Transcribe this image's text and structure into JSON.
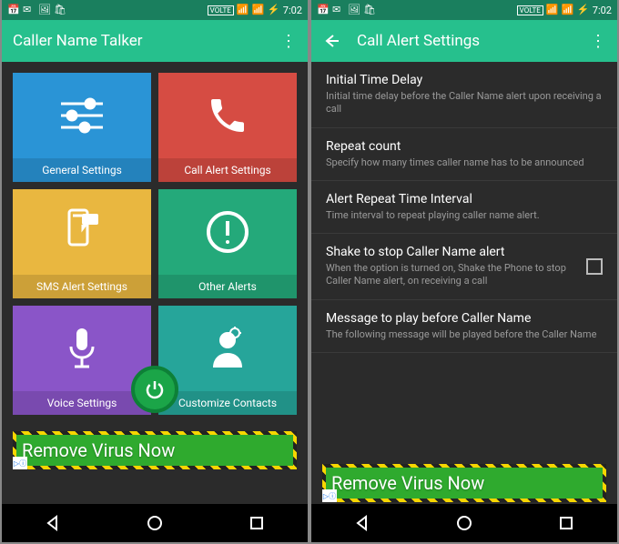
{
  "status": {
    "time": "7:02",
    "volte": "VOLTE"
  },
  "left": {
    "title": "Caller Name Talker",
    "tiles": [
      {
        "label": "General Settings"
      },
      {
        "label": "Call Alert Settings"
      },
      {
        "label": "SMS Alert Settings"
      },
      {
        "label": "Other Alerts"
      },
      {
        "label": "Voice Settings"
      },
      {
        "label": "Customize Contacts"
      }
    ]
  },
  "right": {
    "title": "Call Alert Settings",
    "items": [
      {
        "title": "Initial Time Delay",
        "sub": "Initial time delay before the Caller Name alert upon receiving a call"
      },
      {
        "title": "Repeat count",
        "sub": "Specify how many times caller name has to be announced"
      },
      {
        "title": "Alert Repeat Time Interval",
        "sub": "Time interval to repeat playing caller name alert."
      },
      {
        "title": "Shake to stop Caller Name alert",
        "sub": "When the option is turned on, Shake the Phone to stop Caller Name alert, on receiving a call"
      },
      {
        "title": "Message to play before Caller Name",
        "sub": "The following message will be played before the Caller Name"
      }
    ]
  },
  "ad": {
    "text": "Remove Virus Now",
    "badge": "▷ⓘ"
  }
}
